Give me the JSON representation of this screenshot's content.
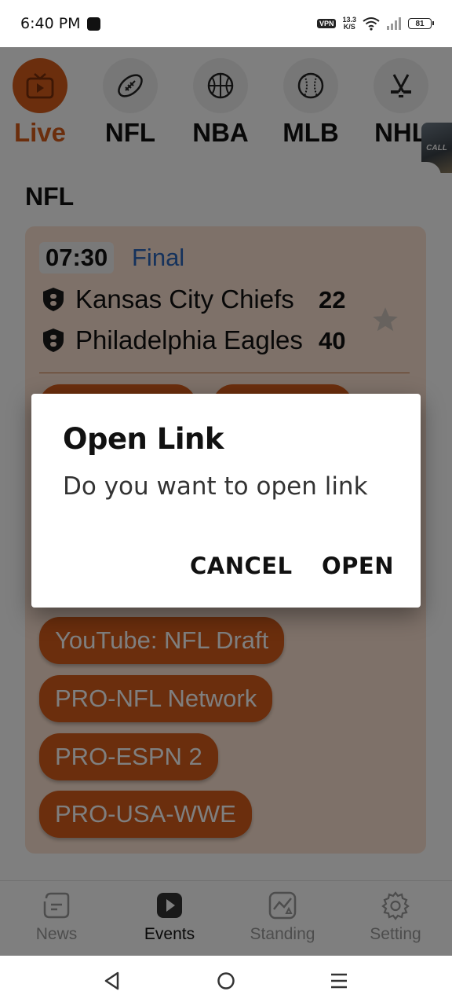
{
  "status_bar": {
    "time": "6:40 PM",
    "vpn": "VPN",
    "net_speed_value": "13.3",
    "net_speed_unit": "K/S",
    "battery": "81"
  },
  "sports_tabs": [
    {
      "label": "Live",
      "icon": "tv-icon",
      "active": true
    },
    {
      "label": "NFL",
      "icon": "football-icon"
    },
    {
      "label": "NBA",
      "icon": "basketball-icon"
    },
    {
      "label": "MLB",
      "icon": "baseball-icon"
    },
    {
      "label": "NHL",
      "icon": "hockey-icon"
    }
  ],
  "ad_thumbnail": {
    "text": "CALL"
  },
  "section": {
    "title": "NFL"
  },
  "match": {
    "time": "07:30",
    "status": "Final",
    "teams": [
      {
        "name": "Kansas City Chiefs",
        "score": "22"
      },
      {
        "name": "Philadelphia Eagles",
        "score": "40"
      }
    ],
    "streams": [
      "YouTube: NFL Draft",
      "PRO-NFL Network",
      "PRO-ESPN 2",
      "PRO-USA-WWE"
    ]
  },
  "dialog": {
    "title": "Open Link",
    "message": "Do you want to open link",
    "cancel_label": "CANCEL",
    "open_label": "OPEN"
  },
  "bottom_nav": [
    {
      "label": "News",
      "icon": "news-icon"
    },
    {
      "label": "Events",
      "icon": "events-icon",
      "active": true
    },
    {
      "label": "Standing",
      "icon": "standing-icon"
    },
    {
      "label": "Setting",
      "icon": "gear-icon"
    }
  ],
  "colors": {
    "accent": "#d65c1b",
    "status_final": "#2b64b8"
  }
}
